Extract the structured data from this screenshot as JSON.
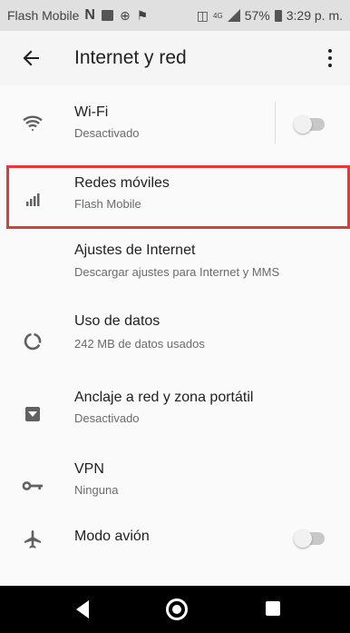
{
  "status_bar": {
    "carrier": "Flash Mobile",
    "signal_badge": "4G",
    "battery": "57%",
    "time": "3:29 p. m."
  },
  "app_bar": {
    "title": "Internet y red"
  },
  "items": [
    {
      "title": "Wi-Fi",
      "subtitle": "Desactivado",
      "icon": "wifi-icon",
      "toggle": false
    },
    {
      "title": "Redes móviles",
      "subtitle": "Flash Mobile",
      "icon": "signal-icon"
    },
    {
      "title": "Ajustes de Internet",
      "subtitle": "Descargar ajustes para Internet y MMS"
    },
    {
      "title": "Uso de datos",
      "subtitle": "242 MB de datos usados",
      "icon": "data-usage-icon"
    },
    {
      "title": "Anclaje a red y zona portátil",
      "subtitle": "Desactivado",
      "icon": "hotspot-icon"
    },
    {
      "title": "VPN",
      "subtitle": "Ninguna",
      "icon": "vpn-key-icon"
    },
    {
      "title": "Modo avión",
      "icon": "airplane-icon",
      "toggle": false
    }
  ],
  "colors": {
    "highlight": "#e53935",
    "status_bar_bg": "#e0e0e0",
    "nav_bar_bg": "#000000"
  }
}
